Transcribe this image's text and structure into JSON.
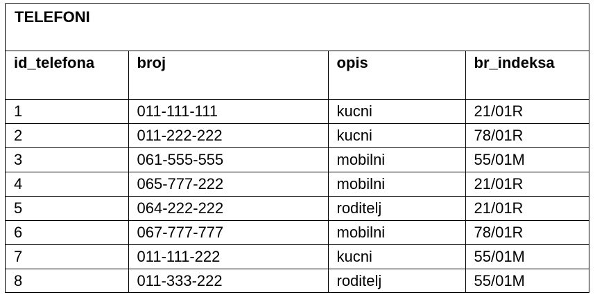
{
  "table": {
    "title": "TELEFONI",
    "columns": [
      "id_telefona",
      "broj",
      "opis",
      "br_indeksa"
    ],
    "rows": [
      [
        "1",
        "011-111-111",
        "kucni",
        "21/01R"
      ],
      [
        "2",
        "011-222-222",
        "kucni",
        "78/01R"
      ],
      [
        "3",
        "061-555-555",
        "mobilni",
        "55/01M"
      ],
      [
        "4",
        "065-777-222",
        "mobilni",
        "21/01R"
      ],
      [
        "5",
        "064-222-222",
        "roditelj",
        "21/01R"
      ],
      [
        "6",
        "067-777-777",
        "mobilni",
        "78/01R"
      ],
      [
        "7",
        "011-111-222",
        "kucni",
        "55/01M"
      ],
      [
        "8",
        "011-333-222",
        "roditelj",
        "55/01M"
      ]
    ]
  }
}
